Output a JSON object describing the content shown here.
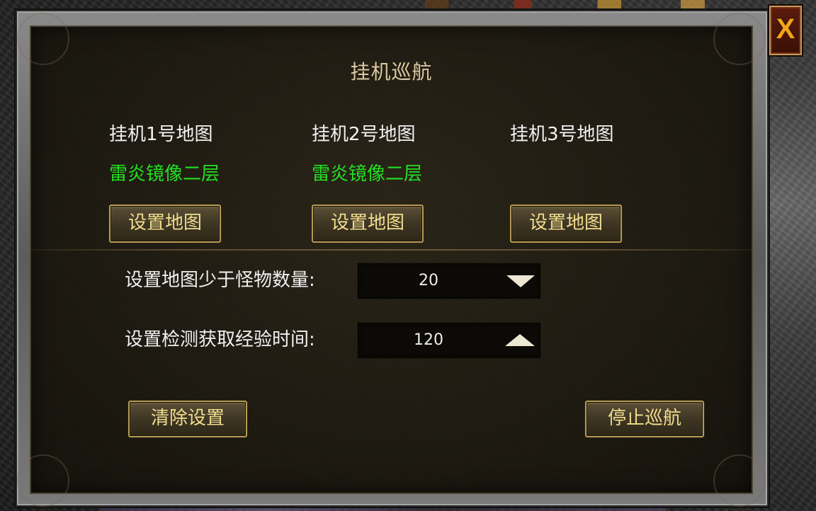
{
  "window": {
    "title": "挂机巡航",
    "close_label": "X"
  },
  "maps": [
    {
      "label": "挂机1号地图",
      "value": "雷炎镜像二层",
      "button": "设置地图"
    },
    {
      "label": "挂机2号地图",
      "value": "雷炎镜像二层",
      "button": "设置地图"
    },
    {
      "label": "挂机3号地图",
      "value": "",
      "button": "设置地图"
    }
  ],
  "settings": {
    "monster_count": {
      "label": "设置地图少于怪物数量:",
      "value": "20"
    },
    "exp_check_time": {
      "label": "设置检测获取经验时间:",
      "value": "120"
    }
  },
  "actions": {
    "clear_label": "清除设置",
    "stop_label": "停止巡航"
  },
  "colors": {
    "map_value": "#22e022",
    "button_text": "#f1dc8e",
    "title": "#d9c9a0",
    "close_x": "#f6a21a"
  }
}
